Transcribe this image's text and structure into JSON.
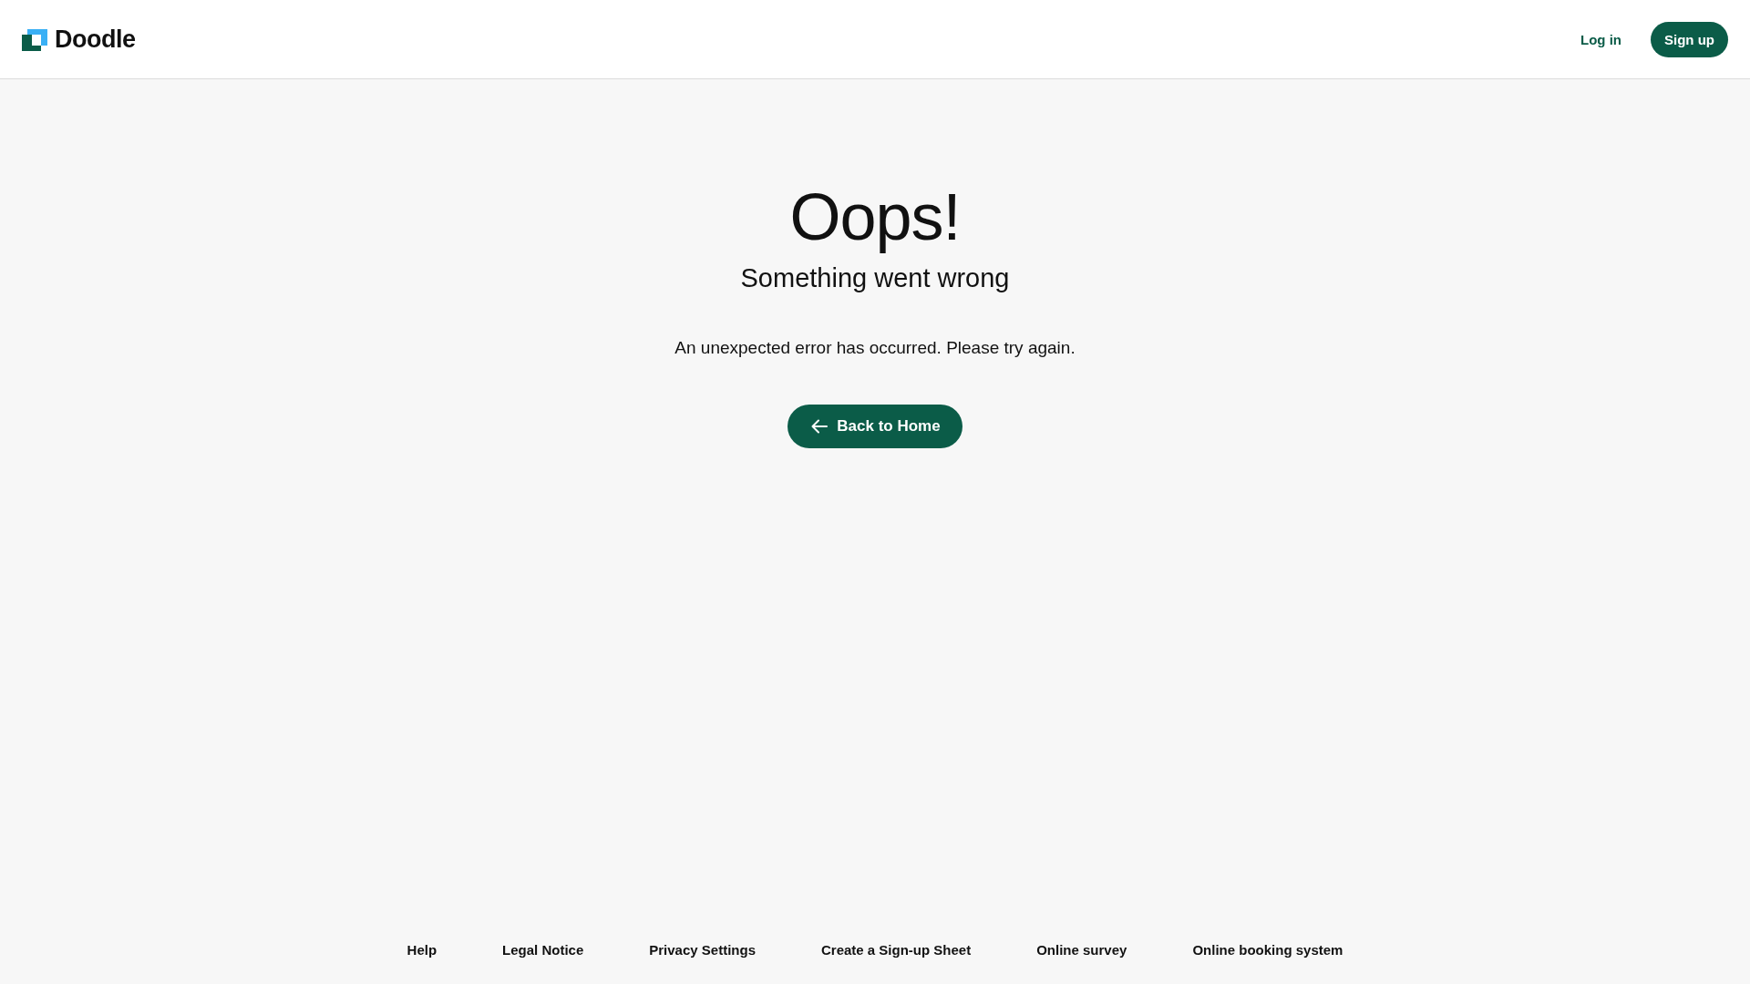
{
  "header": {
    "logo_text": "Doodle",
    "login": "Log in",
    "signup": "Sign up"
  },
  "error": {
    "title": "Oops!",
    "subtitle": "Something went wrong",
    "message": "An unexpected error has occurred. Please try again.",
    "button": "Back to Home"
  },
  "footer": {
    "links": [
      "Help",
      "Legal Notice",
      "Privacy Settings",
      "Create a Sign-up Sheet",
      "Online survey",
      "Online booking system"
    ]
  }
}
